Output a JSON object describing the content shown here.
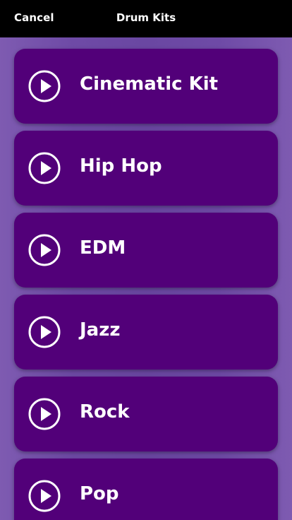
{
  "header": {
    "cancel_label": "Cancel",
    "title": "Drum Kits"
  },
  "kits": [
    {
      "label": "Cinematic Kit",
      "icon": "play-icon"
    },
    {
      "label": "Hip Hop",
      "icon": "play-icon"
    },
    {
      "label": "EDM",
      "icon": "play-icon"
    },
    {
      "label": "Jazz",
      "icon": "play-icon"
    },
    {
      "label": "Rock",
      "icon": "play-icon"
    },
    {
      "label": "Pop",
      "icon": "play-icon"
    }
  ],
  "colors": {
    "card_background": "#520079",
    "page_background": "#6a47a2",
    "header_background": "#000000",
    "text": "#ffffff"
  }
}
